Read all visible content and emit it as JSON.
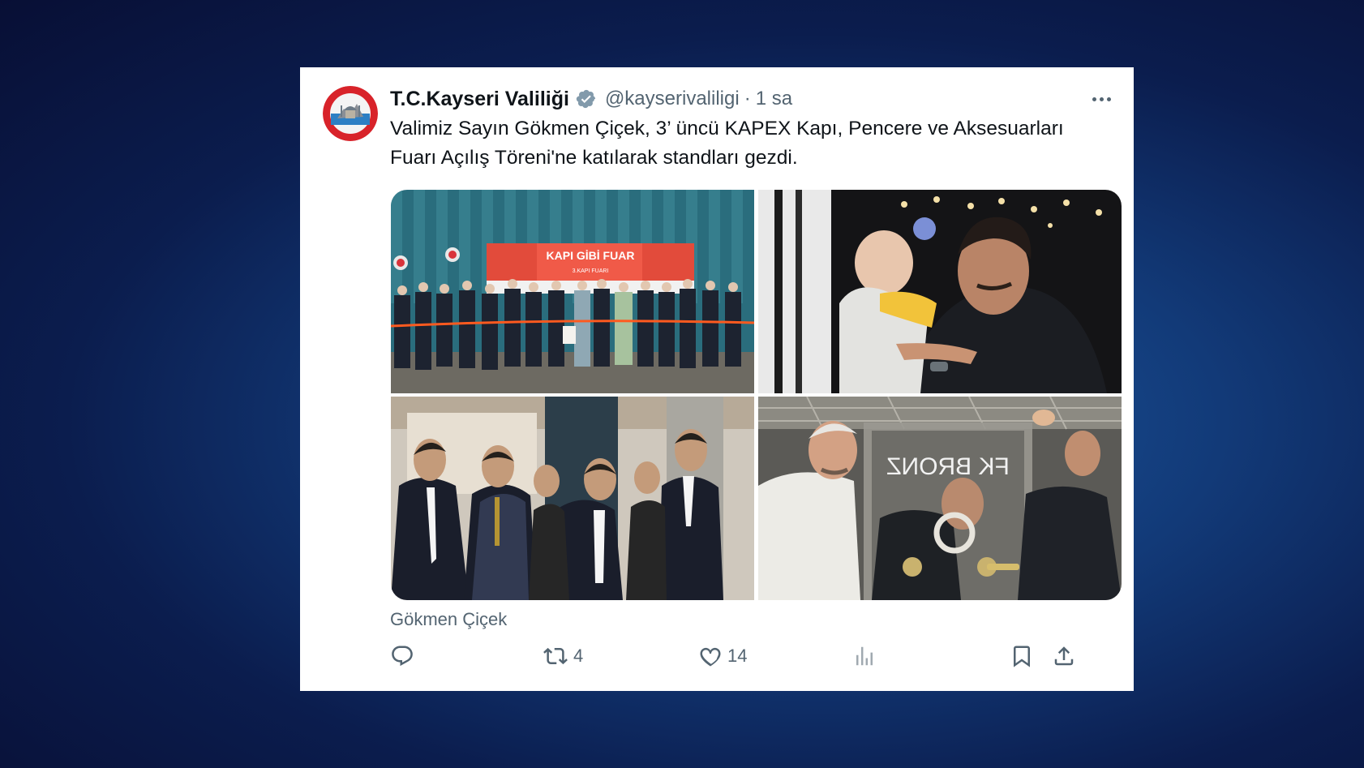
{
  "tweet": {
    "display_name": "T.C.Kayseri Valiliği",
    "handle": "@kayserivaliligi",
    "separator": "·",
    "time": "1 sa",
    "text_line1": "Valimiz Sayın Gökmen Çiçek, 3’ üncü KAPEX Kapı, Pencere ve Aksesuarları",
    "text_line2": "Fuarı Açılış Töreni'ne katılarak standları gezdi.",
    "media_caption": "Gökmen Çiçek",
    "banner_text": "KAPI GİBİ FUAR",
    "banner_sub": "3.KAPI FUARI",
    "plaque_text": "FK BRONZ"
  },
  "actions": {
    "reply_count": "",
    "retweet_count": "4",
    "like_count": "14",
    "views_count": ""
  },
  "colors": {
    "verified": "#829aab",
    "icon_gray": "#536471",
    "text": "#0f1419"
  },
  "icons": [
    "verified-badge-icon",
    "more-icon",
    "reply-icon",
    "retweet-icon",
    "like-icon",
    "views-icon",
    "bookmark-icon",
    "share-icon"
  ]
}
